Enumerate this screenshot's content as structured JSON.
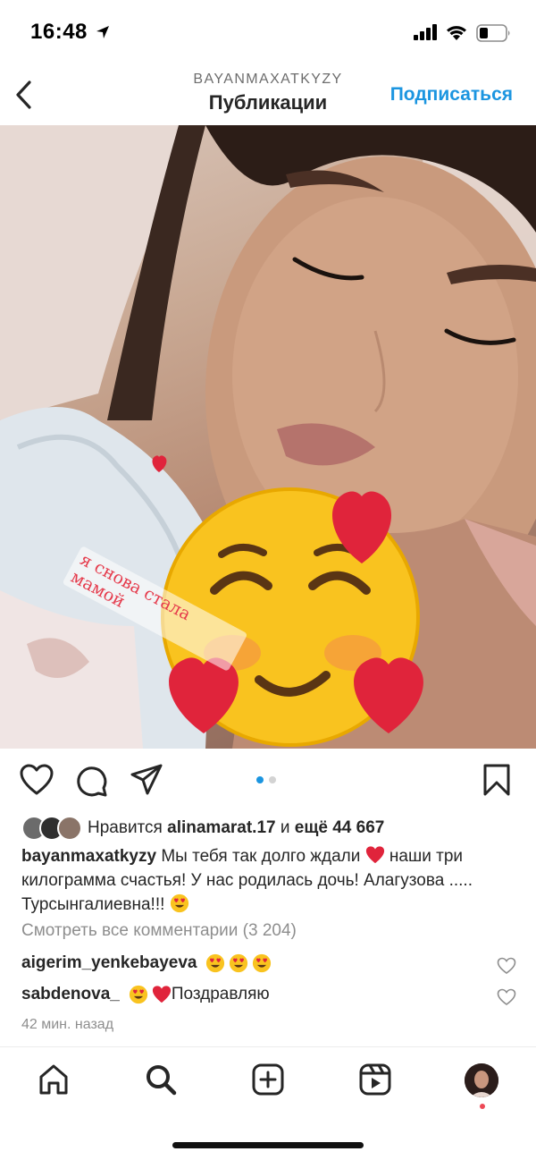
{
  "status_bar": {
    "time": "16:48"
  },
  "header": {
    "username": "BAYANMAXATKYZY",
    "title": "Публикации",
    "follow_label": "Подписаться"
  },
  "post": {
    "sticker_text": "я снова стала мамой",
    "carousel": {
      "count": 2,
      "active_index": 1
    },
    "likes": {
      "prefix": "Нравится ",
      "user": "alinamarat.17",
      "middle": " и ",
      "others": "ещё 44 667"
    },
    "caption": {
      "author": "bayanmaxatkyzy",
      "text_part1": " Мы тебя так долго ждали ",
      "text_part2": " наши три килограмма счастья! У нас родилась дочь! Алагузова ..... Турсынгалиевна!!! "
    },
    "view_comments": "Смотреть все комментарии (3 204)",
    "comments": [
      {
        "user": "aigerim_yenkebayeva",
        "text": ""
      },
      {
        "user": "sabdenova_",
        "text": "Поздравляю"
      }
    ],
    "timestamp": "42 мин. назад"
  },
  "colors": {
    "accent": "#1b95e0",
    "heart": "#e0243b",
    "muted": "#8e8e8e",
    "notification": "#ed4956"
  },
  "icons": [
    "back-chevron-icon",
    "heart-icon",
    "comment-icon",
    "share-icon",
    "bookmark-icon",
    "home-icon",
    "search-icon",
    "new-post-icon",
    "reels-icon"
  ]
}
